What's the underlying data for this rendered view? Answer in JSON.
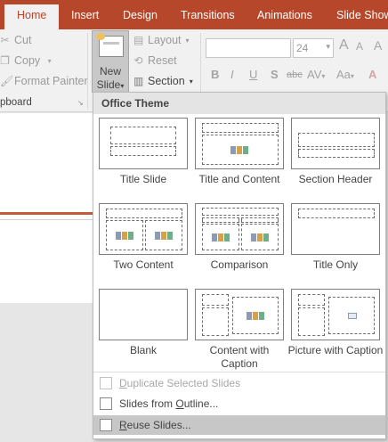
{
  "tabs": {
    "home": "Home",
    "insert": "Insert",
    "design": "Design",
    "transitions": "Transitions",
    "animations": "Animations",
    "slideshow": "Slide Show"
  },
  "clipboard": {
    "cut": "Cut",
    "copy": "Copy",
    "format_painter": "Format Painter",
    "group_label": "pboard"
  },
  "slides_group": {
    "new_slide_line1": "New",
    "new_slide_line2": "Slide",
    "layout": "Layout",
    "reset": "Reset",
    "section": "Section"
  },
  "font": {
    "size": "24",
    "bold": "B",
    "italic": "I",
    "underline": "U",
    "shadow": "S",
    "strikethrough": "abc",
    "spacing": "AV",
    "case": "Aa"
  },
  "menu": {
    "header": "Office Theme",
    "layouts": [
      {
        "label": "Title Slide"
      },
      {
        "label": "Title and Content"
      },
      {
        "label": "Section Header"
      },
      {
        "label": "Two Content"
      },
      {
        "label": "Comparison"
      },
      {
        "label": "Title Only"
      },
      {
        "label": "Blank"
      },
      {
        "label": "Content with Caption"
      },
      {
        "label": "Picture with Caption"
      }
    ],
    "duplicate": {
      "key": "D",
      "rest": "uplicate Selected Slides"
    },
    "outline": {
      "before": "Slides from ",
      "key": "O",
      "after": "utline..."
    },
    "reuse": {
      "key": "R",
      "rest": "euse Slides..."
    }
  },
  "colors": {
    "tab_accent": "#b7472a",
    "ribbon_bg": "#f1f1f1",
    "menu_header_bg": "#e4e4e4",
    "hover_bg": "#c7c7c7"
  }
}
